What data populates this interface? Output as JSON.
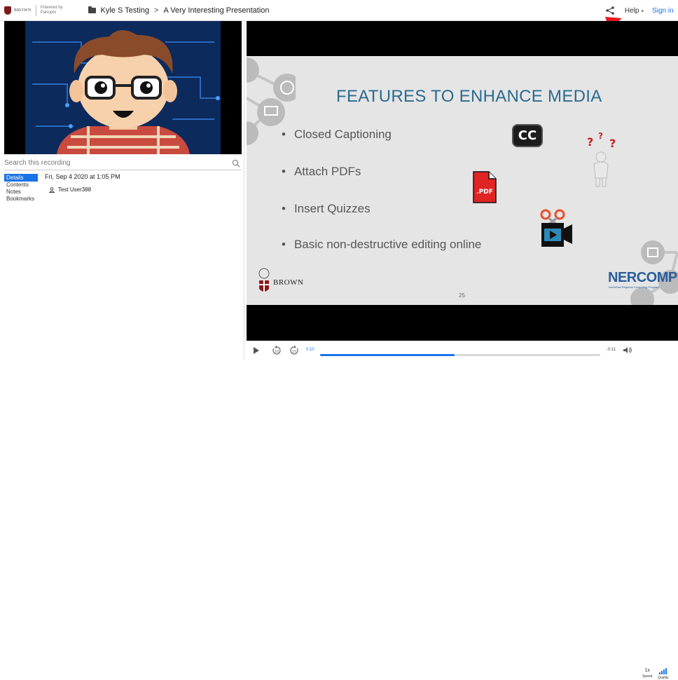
{
  "header": {
    "brand_name": "BROWN",
    "powered_by": "Powered by",
    "powered_by_name": "Panopto",
    "folder": "Kyle S Testing",
    "separator": ">",
    "title": "A Very Interesting Presentation",
    "help_label": "Help",
    "signin_label": "Sign in",
    "share_icon": "share-icon"
  },
  "sidebar": {
    "search_placeholder": "Search this recording",
    "tabs": [
      {
        "label": "Details",
        "active": true
      },
      {
        "label": "Contents",
        "active": false
      },
      {
        "label": "Notes",
        "active": false
      },
      {
        "label": "Bookmarks",
        "active": false
      }
    ],
    "details": {
      "date": "Fri, Sep 4 2020 at 1:05 PM",
      "user": "Test User388"
    }
  },
  "slide": {
    "title": "FEATURES TO ENHANCE MEDIA",
    "bullets": [
      "Closed Captioning",
      "Attach PDFs",
      "Insert Quizzes",
      "Basic non-destructive editing online"
    ],
    "cc_label": "CC",
    "pdf_label": ".PDF",
    "page_number": "25",
    "logo_left": "BROWN",
    "logo_right": "NERCOMP",
    "logo_right_sub": "NorthEast Regional Computing Program"
  },
  "controls": {
    "current_time": "0:10",
    "remaining_time": "-0:11",
    "progress": 0.48,
    "rewind_label": "10",
    "forward_label": "15",
    "speed_value": "1x",
    "speed_label": "Speed",
    "quality_label": "Quality"
  },
  "colors": {
    "accent": "#1a73e8",
    "slide_title": "#2b6a8e",
    "arrow": "#e8191f"
  }
}
